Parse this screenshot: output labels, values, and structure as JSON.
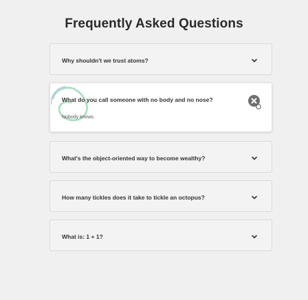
{
  "page": {
    "title": "Frequently Asked Questions"
  },
  "faqs": [
    {
      "question": "Why shouldn't we trust atoms?",
      "expanded": false
    },
    {
      "question": "What do you call someone with no body and no nose?",
      "answer": "Nobody knows.",
      "expanded": true
    },
    {
      "question": "What's the object-oriented way to become wealthy?",
      "expanded": false
    },
    {
      "question": "How many tickles does it take to tickle an octopus?",
      "expanded": false
    },
    {
      "question": "What is: 1 + 1?",
      "expanded": false
    }
  ],
  "icons": {
    "collapsed": "chevron-down-icon",
    "expanded": "close-icon"
  },
  "colors": {
    "background": "#f0f0f0",
    "card_bg": "#f3f3f3",
    "active_card_bg": "#ffffff",
    "text": "#333333",
    "close_button": "#6f6f6f",
    "decoration": "#5cc28a"
  }
}
